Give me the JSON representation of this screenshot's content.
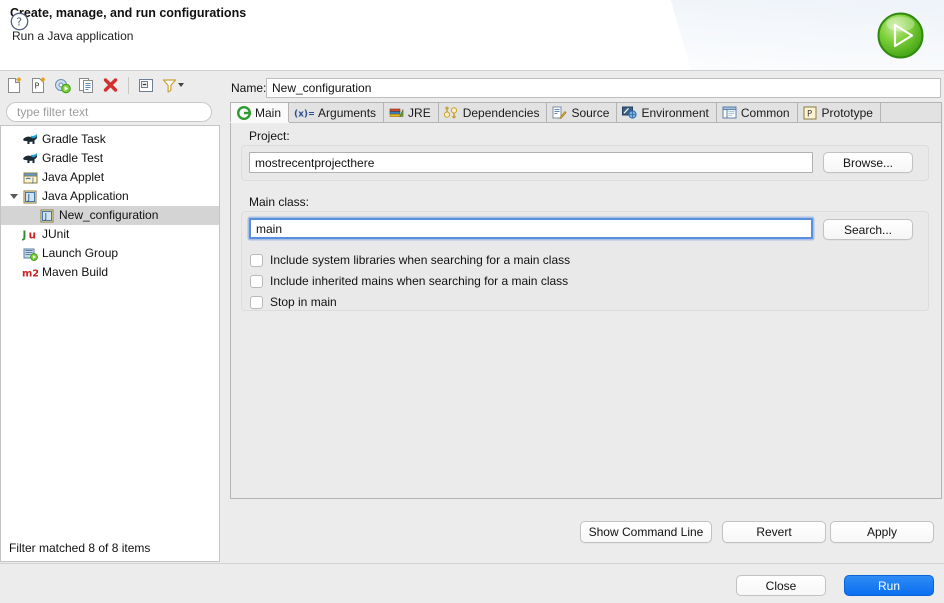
{
  "header": {
    "title": "Create, manage, and run configurations",
    "subtitle": "Run a Java application",
    "icon": "run-play-icon"
  },
  "toolbar": {
    "buttons": [
      {
        "name": "new-launch-configuration-icon",
        "tooltip": "New launch configuration"
      },
      {
        "name": "new-prototype-icon",
        "tooltip": "New prototype"
      },
      {
        "name": "export-launch-configuration-icon",
        "tooltip": "Export launch configuration"
      },
      {
        "name": "duplicate-icon",
        "tooltip": "Duplicate"
      },
      {
        "name": "delete-icon",
        "tooltip": "Delete"
      },
      {
        "name": "collapse-all-icon",
        "tooltip": "Collapse All"
      },
      {
        "name": "filter-icon",
        "tooltip": "Filter"
      }
    ]
  },
  "filter": {
    "placeholder": "type filter text",
    "value": "",
    "status": "Filter matched 8 of 8 items"
  },
  "tree": {
    "items": [
      {
        "label": "Gradle Task",
        "icon": "gradle-elephant-icon",
        "indent": 0,
        "twisty": "none",
        "selected": false
      },
      {
        "label": "Gradle Test",
        "icon": "gradle-elephant-icon",
        "indent": 0,
        "twisty": "none",
        "selected": false
      },
      {
        "label": "Java Applet",
        "icon": "java-applet-icon",
        "indent": 0,
        "twisty": "none",
        "selected": false
      },
      {
        "label": "Java Application",
        "icon": "java-application-icon",
        "indent": 0,
        "twisty": "expanded",
        "selected": false
      },
      {
        "label": "New_configuration",
        "icon": "java-application-icon",
        "indent": 1,
        "twisty": "none",
        "selected": true
      },
      {
        "label": "JUnit",
        "icon": "junit-icon",
        "indent": 0,
        "twisty": "none",
        "selected": false
      },
      {
        "label": "Launch Group",
        "icon": "launch-group-icon",
        "indent": 0,
        "twisty": "none",
        "selected": false
      },
      {
        "label": "Maven Build",
        "icon": "maven-m2-icon",
        "indent": 0,
        "twisty": "none",
        "selected": false
      }
    ]
  },
  "config": {
    "name_label": "Name:",
    "name_value": "New_configuration",
    "tabs": [
      {
        "label": "Main",
        "icon": "main-green-circle-icon",
        "active": true
      },
      {
        "label": "Arguments",
        "icon": "arguments-xeq-icon",
        "active": false
      },
      {
        "label": "JRE",
        "icon": "jre-books-icon",
        "active": false
      },
      {
        "label": "Dependencies",
        "icon": "dependencies-icon",
        "active": false
      },
      {
        "label": "Source",
        "icon": "source-pencil-icon",
        "active": false
      },
      {
        "label": "Environment",
        "icon": "environment-icon",
        "active": false
      },
      {
        "label": "Common",
        "icon": "common-window-icon",
        "active": false
      },
      {
        "label": "Prototype",
        "icon": "prototype-p-icon",
        "active": false
      }
    ],
    "project": {
      "label": "Project:",
      "value": "mostrecentprojecthere",
      "browse_label": "Browse..."
    },
    "main_class": {
      "label": "Main class:",
      "value": "main",
      "search_label": "Search...",
      "focused": true
    },
    "checkboxes": [
      {
        "label": "Include system libraries when searching for a main class",
        "checked": false
      },
      {
        "label": "Include inherited mains when searching for a main class",
        "checked": false
      },
      {
        "label": "Stop in main",
        "checked": false
      }
    ]
  },
  "actions": {
    "show_command_line": "Show Command Line",
    "revert": "Revert",
    "apply": "Apply"
  },
  "footer": {
    "help_icon": "help-question-icon",
    "close": "Close",
    "run": "Run"
  },
  "colors": {
    "run_accent": "#0a6ff0",
    "focus_ring": "#5a8fe0",
    "selection": "#d4d4d4",
    "panel_bg": "#ececec",
    "tab_active": "#fafafa",
    "green_play": "#4caf1f"
  }
}
